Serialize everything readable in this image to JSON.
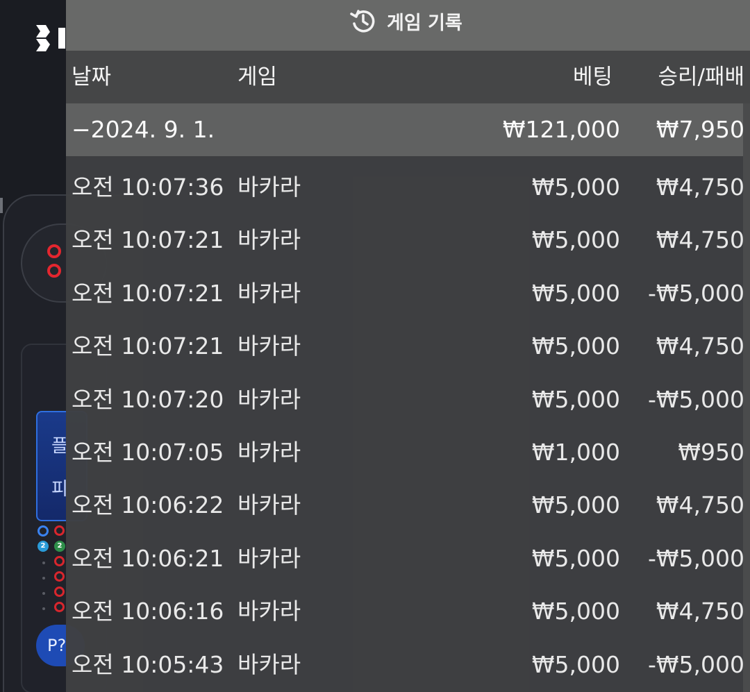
{
  "panel": {
    "title": "게임 기록",
    "title_icon": "history-icon",
    "columns": {
      "date": "날짜",
      "game": "게임",
      "bet": "베팅",
      "result": "승리/패배"
    },
    "summary": {
      "date": "−2024. 9. 1.",
      "bet": "₩121,000",
      "result": "₩7,950"
    },
    "rows": [
      {
        "time": "오전 10:07:36",
        "game": "바카라",
        "bet": "₩5,000",
        "result": "₩4,750"
      },
      {
        "time": "오전 10:07:21",
        "game": "바카라",
        "bet": "₩5,000",
        "result": "₩4,750"
      },
      {
        "time": "오전 10:07:21",
        "game": "바카라",
        "bet": "₩5,000",
        "result": "-₩5,000"
      },
      {
        "time": "오전 10:07:21",
        "game": "바카라",
        "bet": "₩5,000",
        "result": "₩4,750"
      },
      {
        "time": "오전 10:07:20",
        "game": "바카라",
        "bet": "₩5,000",
        "result": "-₩5,000"
      },
      {
        "time": "오전 10:07:05",
        "game": "바카라",
        "bet": "₩1,000",
        "result": "₩950"
      },
      {
        "time": "오전 10:06:22",
        "game": "바카라",
        "bet": "₩5,000",
        "result": "₩4,750"
      },
      {
        "time": "오전 10:06:21",
        "game": "바카라",
        "bet": "₩5,000",
        "result": "-₩5,000"
      },
      {
        "time": "오전 10:06:16",
        "game": "바카라",
        "bet": "₩5,000",
        "result": "₩4,750"
      },
      {
        "time": "오전 10:05:43",
        "game": "바카라",
        "bet": "₩5,000",
        "result": "-₩5,000"
      }
    ]
  },
  "background": {
    "tile_chars": [
      "플",
      "피"
    ],
    "badges": [
      "2",
      "2"
    ],
    "pill_label": "P?"
  },
  "colors": {
    "title_bar": "#686968",
    "header_bg": "#454647",
    "summary_bg": "#606161",
    "panel_bg": "#3f4042",
    "road_red": "#e3262f",
    "accent_blue": "#2f6fe0"
  }
}
